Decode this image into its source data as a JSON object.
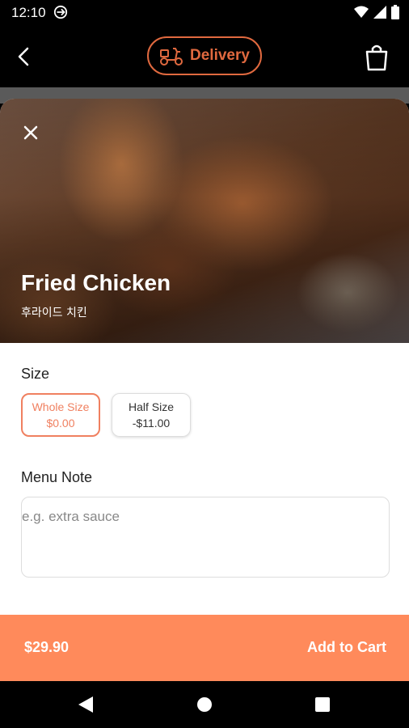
{
  "status_bar": {
    "time": "12:10"
  },
  "header": {
    "delivery_label": "Delivery"
  },
  "item": {
    "name": "Fried Chicken",
    "subtitle": "후라이드 치킨"
  },
  "size": {
    "label": "Size",
    "options": [
      {
        "name": "Whole Size",
        "price": "$0.00",
        "selected": true
      },
      {
        "name": "Half Size",
        "price": "-$11.00",
        "selected": false
      }
    ]
  },
  "menu_note": {
    "label": "Menu Note",
    "placeholder": "e.g. extra sauce"
  },
  "cart": {
    "price": "$29.90",
    "add_label": "Add to Cart"
  },
  "colors": {
    "accent": "#e0693f",
    "cart_bar": "#ff8a5b",
    "selected_option": "#f08060"
  },
  "icons": [
    "sync-icon",
    "wifi-icon",
    "signal-icon",
    "battery-icon",
    "back-arrow-icon",
    "scooter-icon",
    "shopping-bag-icon",
    "close-icon",
    "nav-back-icon",
    "nav-home-icon",
    "nav-recents-icon"
  ]
}
